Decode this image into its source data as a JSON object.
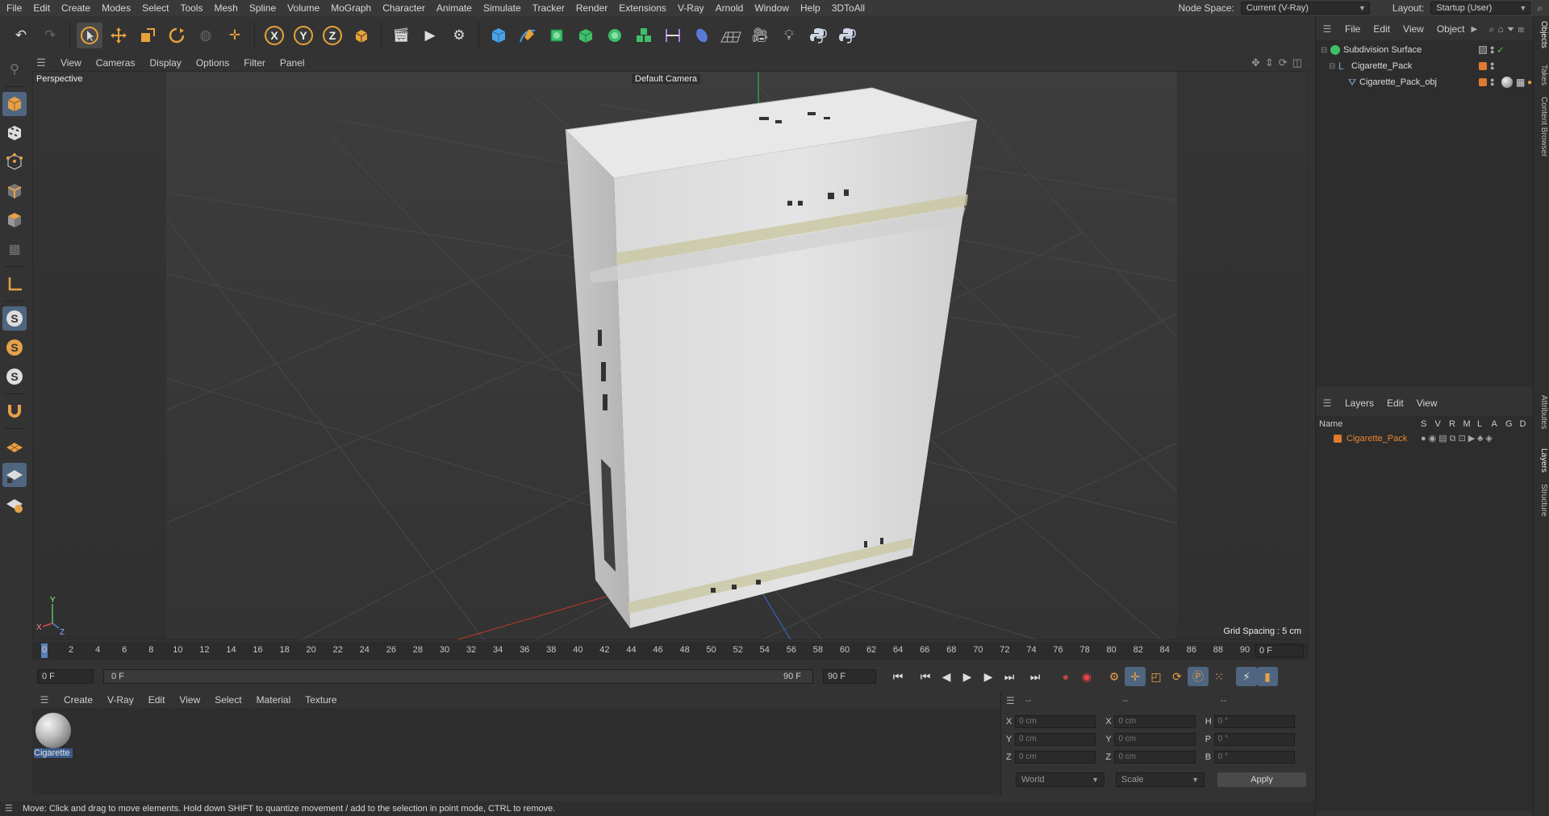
{
  "menu": [
    "File",
    "Edit",
    "Create",
    "Modes",
    "Select",
    "Tools",
    "Mesh",
    "Spline",
    "Volume",
    "MoGraph",
    "Character",
    "Animate",
    "Simulate",
    "Tracker",
    "Render",
    "Extensions",
    "V-Ray",
    "Arnold",
    "Window",
    "Help",
    "3DToAll"
  ],
  "node_space": {
    "label": "Node Space:",
    "value": "Current (V-Ray)"
  },
  "layout": {
    "label": "Layout:",
    "value": "Startup (User)"
  },
  "toolbar": {
    "x": "X",
    "y": "Y",
    "z": "Z"
  },
  "left_tools": {
    "s1": "S",
    "s2": "S",
    "s3": "S"
  },
  "viewport_menu": [
    "View",
    "Cameras",
    "Display",
    "Options",
    "Filter",
    "Panel"
  ],
  "viewport": {
    "name": "Perspective",
    "camera": "Default Camera",
    "grid_spacing": "Grid Spacing : 5 cm"
  },
  "timeline": {
    "ticks": [
      "0",
      "2",
      "4",
      "6",
      "8",
      "10",
      "12",
      "14",
      "16",
      "18",
      "20",
      "22",
      "24",
      "26",
      "28",
      "30",
      "32",
      "34",
      "36",
      "38",
      "40",
      "42",
      "44",
      "46",
      "48",
      "50",
      "52",
      "54",
      "56",
      "58",
      "60",
      "62",
      "64",
      "66",
      "68",
      "70",
      "72",
      "74",
      "76",
      "78",
      "80",
      "82",
      "84",
      "86",
      "88",
      "90"
    ],
    "current_frame": "0 F"
  },
  "transport": {
    "start": "0 F",
    "range_start": "0 F",
    "range_end": "90 F",
    "end": "90 F"
  },
  "material_menu": [
    "Create",
    "V-Ray",
    "Edit",
    "View",
    "Select",
    "Material",
    "Texture"
  ],
  "material": {
    "name": "Cigarette"
  },
  "coords": {
    "header": "--",
    "x1": "0 cm",
    "y1": "0 cm",
    "z1": "0 cm",
    "x2": "0 cm",
    "y2": "0 cm",
    "z2": "0 cm",
    "h": "0 °",
    "p": "0 °",
    "b": "0 °",
    "lx": "X",
    "ly": "Y",
    "lz": "Z",
    "lh": "H",
    "lp": "P",
    "lb": "B",
    "space": "World",
    "mode": "Scale",
    "apply": "Apply"
  },
  "status": "Move: Click and drag to move elements. Hold down SHIFT to quantize movement / add to the selection in point mode, CTRL to remove.",
  "objects_menu": [
    "File",
    "Edit",
    "View",
    "Object"
  ],
  "objects": [
    {
      "name": "Subdivision Surface"
    },
    {
      "name": "Cigarette_Pack"
    },
    {
      "name": "Cigarette_Pack_obj"
    }
  ],
  "layers_menu": [
    "Layers",
    "Edit",
    "View"
  ],
  "layers_header": {
    "name": "Name",
    "cols": [
      "S",
      "V",
      "R",
      "M",
      "L",
      "A",
      "G",
      "D"
    ]
  },
  "layers": [
    {
      "name": "Cigarette_Pack",
      "color": "#e07a2e"
    }
  ],
  "side_tabs": [
    "Objects",
    "Takes",
    "Content Browser",
    "Attributes",
    "Layers",
    "Structure"
  ],
  "axis": {
    "x": "X",
    "y": "Y",
    "z": "Z"
  },
  "colors": {
    "accent": "#5b82b5",
    "layer": "#e07a2e",
    "selected_label": "#3a5a8a"
  }
}
